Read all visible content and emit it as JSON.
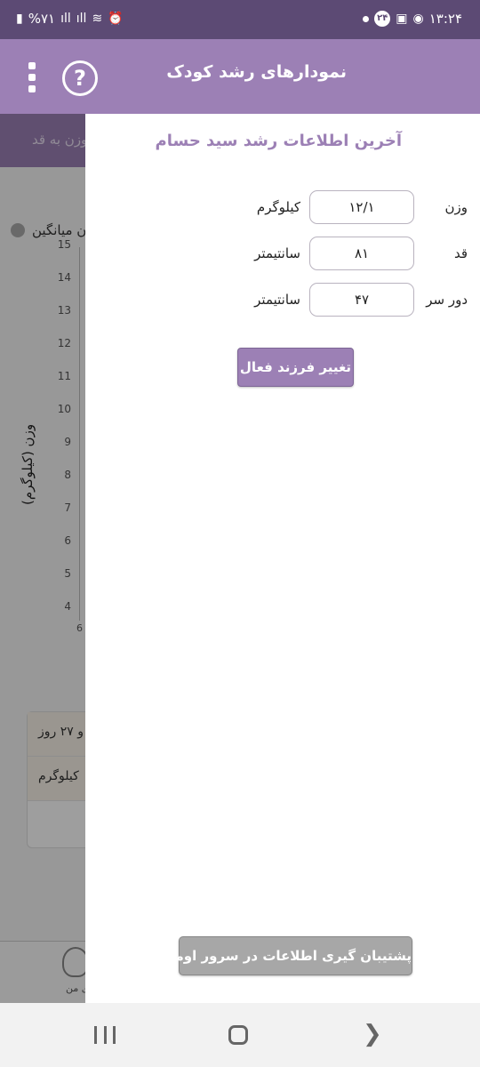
{
  "status_bar": {
    "time": "۱۳:۲۴",
    "notification_count": "۲۴",
    "battery": "%۷۱"
  },
  "app_bar": {
    "title": "نمودارهای رشد کودک",
    "help_glyph": "?",
    "menu_icon": "more-vert-icon"
  },
  "background_screen": {
    "tab_label": "وزن به قد",
    "legend_label": "ن میانگین",
    "y_axis_label": "وزن (کیلوگرم)",
    "y_ticks": [
      "15",
      "14",
      "13",
      "12",
      "11",
      "10",
      "9",
      "8",
      "7",
      "6",
      "5",
      "4"
    ],
    "x_first_tick": "6",
    "card_rows": [
      "و ۲۷ روز",
      "کیلوگرم"
    ],
    "nav_label": "ای من"
  },
  "drawer": {
    "heading": "آخرین اطلاعات رشد سید حسام",
    "fields": [
      {
        "label": "وزن",
        "value": "۱۲/۱",
        "unit": "کیلوگرم"
      },
      {
        "label": "قد",
        "value": "۸۱",
        "unit": "سانتیمتر"
      },
      {
        "label": "دور سر",
        "value": "۴۷",
        "unit": "سانتیمتر"
      }
    ],
    "change_child_button": "تغییر فرزند فعال",
    "backup_button": "پشتیبان گیری اطلاعات در سرور اوما"
  },
  "colors": {
    "primary": "#9c80b5",
    "status_bar": "#5c4a74",
    "disabled_button": "#a7a7a7"
  }
}
